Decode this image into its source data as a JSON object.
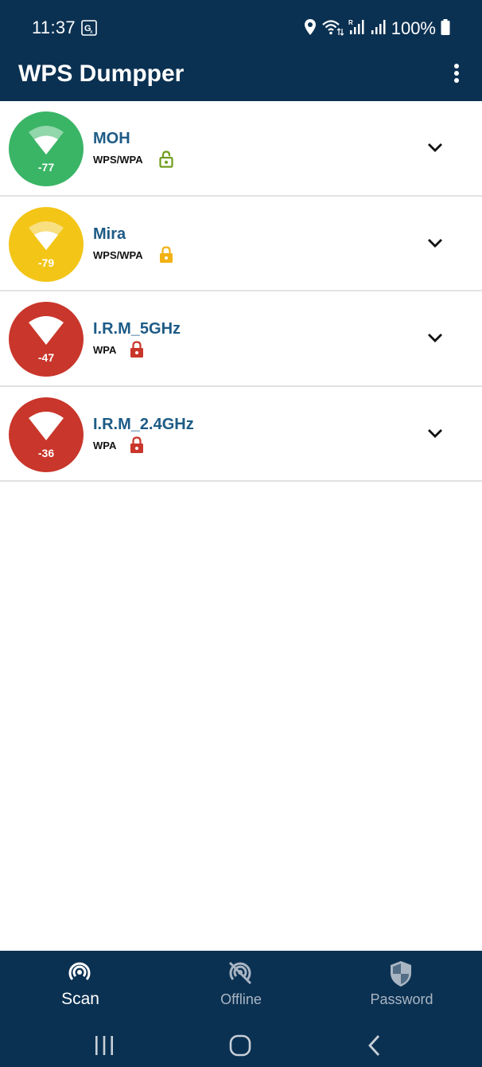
{
  "status_bar": {
    "time": "11:37",
    "battery_percent": "100%",
    "icons": [
      "translate-icon",
      "location-icon",
      "wifi-icon",
      "signal-r-icon",
      "signal-icon",
      "battery-icon"
    ]
  },
  "app_bar": {
    "title": "WPS Dumpper",
    "menu_icon": "more-vert-icon"
  },
  "networks": [
    {
      "name": "MOH",
      "security": "WPS/WPA",
      "signal": "-77",
      "color": "#3ab566",
      "lock_color": "#6f9e1c",
      "lock_state": "unlocked"
    },
    {
      "name": "Mira",
      "security": "WPS/WPA",
      "signal": "-79",
      "color": "#f3c517",
      "lock_color": "#f2b214",
      "lock_state": "locked"
    },
    {
      "name": "I.R.M_5GHz",
      "security": "WPA",
      "signal": "-47",
      "color": "#c9362b",
      "lock_color": "#c9362b",
      "lock_state": "locked"
    },
    {
      "name": "I.R.M_2.4GHz",
      "security": "WPA",
      "signal": "-36",
      "color": "#c9362b",
      "lock_color": "#c9362b",
      "lock_state": "locked"
    }
  ],
  "bottom_nav": {
    "tabs": [
      {
        "label": "Scan",
        "icon": "scan-icon",
        "active": true
      },
      {
        "label": "Offline",
        "icon": "offline-icon",
        "active": false
      },
      {
        "label": "Password",
        "icon": "shield-icon",
        "active": false
      }
    ]
  },
  "colors": {
    "primary": "#0b3152",
    "network_name": "#1d5b86",
    "inactive_tab": "#a9b5c3"
  }
}
